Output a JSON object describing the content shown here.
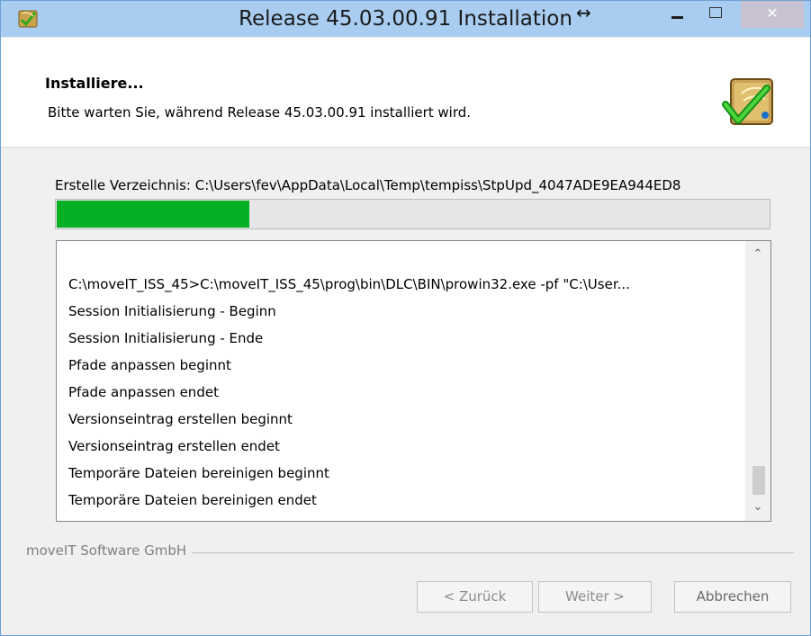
{
  "window": {
    "title": "Release 45.03.00.91 Installation",
    "resize_glyph": "↔",
    "close_glyph": "✕"
  },
  "header": {
    "title": "Installiere...",
    "subtitle": "Bitte warten Sie, während Release 45.03.00.91 installiert wird."
  },
  "status": {
    "text": "Erstelle Verzeichnis: C:\\Users\\fev\\AppData\\Local\\Temp\\tempiss\\StpUpd_4047ADE9EA944ED8"
  },
  "progress": {
    "fraction": 0.27
  },
  "log": {
    "lines": [
      "C:\\moveIT_ISS_45>C:\\moveIT_ISS_45\\prog\\bin\\DLC\\BIN\\prowin32.exe -pf \"C:\\User...",
      "Session Initialisierung - Beginn",
      "Session Initialisierung - Ende",
      "Pfade anpassen beginnt",
      "Pfade anpassen endet",
      "Versionseintrag erstellen beginnt",
      "Versionseintrag erstellen endet",
      "Temporäre Dateien bereinigen beginnt",
      "Temporäre Dateien bereinigen endet"
    ]
  },
  "footer": {
    "brand": "moveIT Software GmbH",
    "back_label": "< Zurück",
    "next_label": "Weiter >",
    "cancel_label": "Abbrechen"
  },
  "icons": {
    "app": "installer-app-icon",
    "header": "installer-check-icon"
  },
  "colors": {
    "titlebar": "#a9cdf1",
    "progress_fill": "#06b025",
    "close_button": "#c7c1d1"
  }
}
